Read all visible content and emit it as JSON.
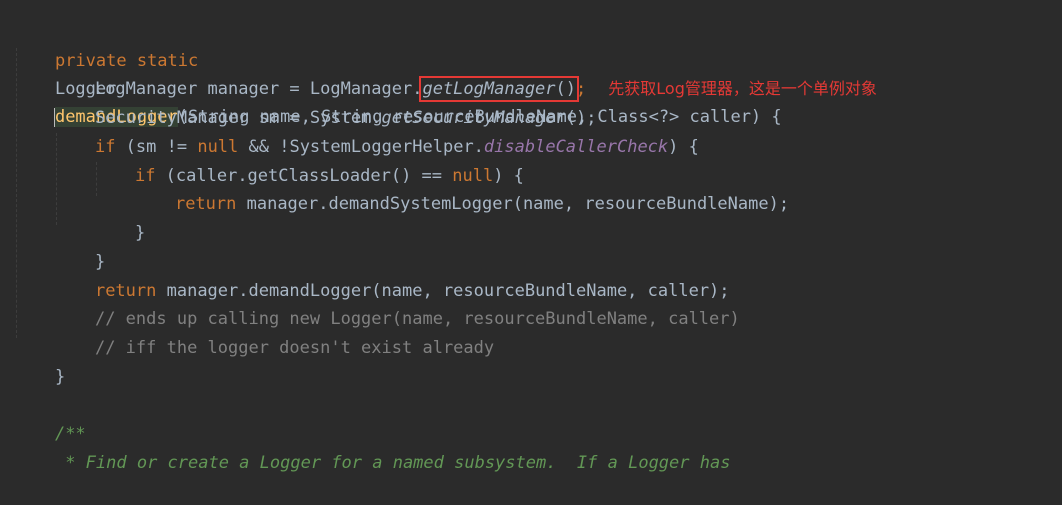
{
  "code": {
    "l1_kw": "private static",
    "l1_type": "Logger",
    "l1_method": "demandLogger",
    "l1_params": "(String name, String resourceBundleName, Class<?> caller) {",
    "l2_pre": "LogManager manager = LogManager.",
    "l2_call": "getLogManager",
    "l2_parens": "()",
    "l2_semi": ";",
    "l2_annotation": "先获取Log管理器，这是一个单例对象",
    "l3_pre": "SecurityManager sm = System.",
    "l3_call": "getSecurityManager",
    "l3_post": "();",
    "l4_kw": "if",
    "l4_a": " (sm != ",
    "l4_null": "null",
    "l4_b": " && !SystemLoggerHelper.",
    "l4_field": "disableCallerCheck",
    "l4_c": ") {",
    "l5_kw": "if",
    "l5_a": " (caller.getClassLoader() == ",
    "l5_null": "null",
    "l5_b": ") {",
    "l6_kw": "return",
    "l6_a": " manager.demandSystemLogger(name, resourceBundleName);",
    "l7": "}",
    "l8": "}",
    "l9_kw": "return",
    "l9_a": " manager.demandLogger(name, resourceBundleName, caller);",
    "l10": "// ends up calling new Logger(name, resourceBundleName, caller)",
    "l11": "// iff the logger doesn't exist already",
    "l12": "}",
    "l13": "/**",
    "l14": " * Find or create a Logger for a named subsystem.  If a Logger has"
  }
}
